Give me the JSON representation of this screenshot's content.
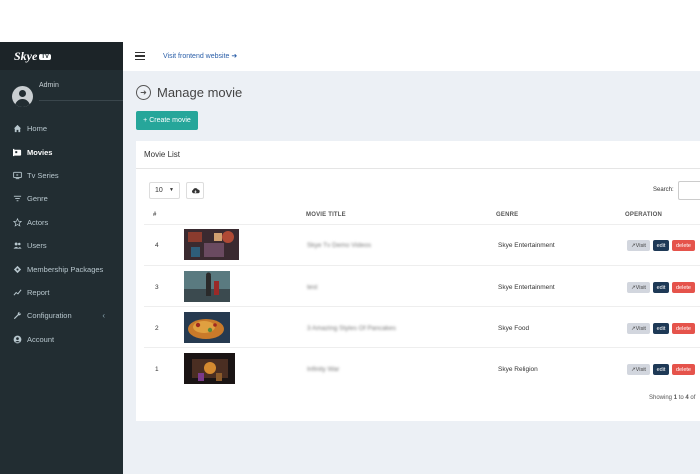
{
  "brand": {
    "logo_text": "Skye",
    "logo_badge": "TV"
  },
  "user": {
    "name": "Admin"
  },
  "sidebar": {
    "items": [
      {
        "label": "Home",
        "icon": "home-icon"
      },
      {
        "label": "Movies",
        "icon": "movie-icon",
        "active": true
      },
      {
        "label": "Tv Series",
        "icon": "tv-icon"
      },
      {
        "label": "Genre",
        "icon": "filter-icon"
      },
      {
        "label": "Actors",
        "icon": "star-icon"
      },
      {
        "label": "Users",
        "icon": "users-icon"
      },
      {
        "label": "Membership Packages",
        "icon": "package-icon"
      },
      {
        "label": "Report",
        "icon": "chart-line-icon"
      },
      {
        "label": "Configuration",
        "icon": "wrench-icon",
        "caret": "‹"
      },
      {
        "label": "Account",
        "icon": "account-icon"
      }
    ]
  },
  "topbar": {
    "visit_link": "Visit frontend website ➜"
  },
  "page": {
    "title": "Manage movie",
    "create_button": "+ Create movie"
  },
  "panel": {
    "title": "Movie List",
    "page_size": "10",
    "search_label": "Search:",
    "columns": {
      "num": "#",
      "title": "MOVIE TITLE",
      "genre": "GENRE",
      "operation": "OPERATION"
    },
    "rows": [
      {
        "num": "4",
        "title": "Skye Tv Demo Videos",
        "genre": "Skye Entertainment"
      },
      {
        "num": "3",
        "title": "test",
        "genre": "Skye Entertainment"
      },
      {
        "num": "2",
        "title": "3 Amazing Styles Of Pancakes",
        "genre": "Skye Food"
      },
      {
        "num": "1",
        "title": "Infinity War",
        "genre": "Skye Religion"
      }
    ],
    "buttons": {
      "visit": "↗Visit",
      "edit": "edit",
      "delete": "delete"
    },
    "showing_prefix": "Showing ",
    "showing_from": "1",
    "showing_mid": " to ",
    "showing_to": "4",
    "showing_suffix": " of "
  },
  "colors": {
    "sidebar": "#222d32",
    "accent": "#26a69a",
    "edit": "#1e3956",
    "delete": "#e5534b"
  }
}
